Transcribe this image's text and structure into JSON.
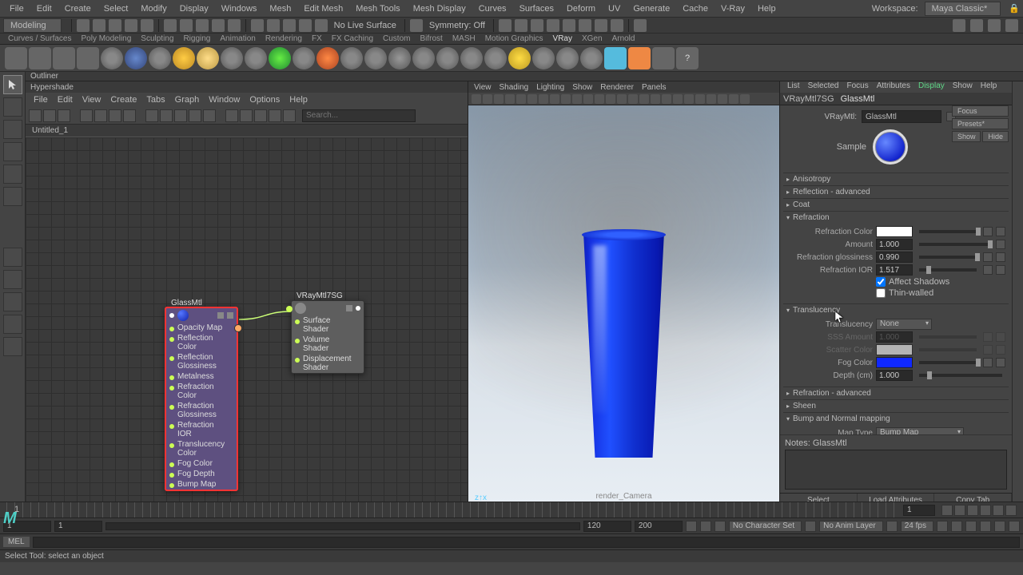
{
  "menubar": [
    "File",
    "Edit",
    "Create",
    "Select",
    "Modify",
    "Display",
    "Windows",
    "Mesh",
    "Edit Mesh",
    "Mesh Tools",
    "Mesh Display",
    "Curves",
    "Surfaces",
    "Deform",
    "UV",
    "Generate",
    "Cache",
    "V-Ray",
    "Help"
  ],
  "workspace": {
    "label": "Workspace:",
    "value": "Maya Classic*"
  },
  "mode": "Modeling",
  "status": {
    "live": "No Live Surface",
    "symmetry": "Symmetry: Off"
  },
  "shelf_tabs": [
    "Curves / Surfaces",
    "Poly Modeling",
    "Sculpting",
    "Rigging",
    "Animation",
    "Rendering",
    "FX",
    "FX Caching",
    "Custom",
    "Bifrost",
    "MASH",
    "Motion Graphics",
    "VRay",
    "XGen",
    "Arnold"
  ],
  "shelf_active": "VRay",
  "outliner": "Outliner",
  "hypershade": {
    "title": "Hypershade",
    "menu": [
      "File",
      "Edit",
      "View",
      "Create",
      "Tabs",
      "Graph",
      "Window",
      "Options",
      "Help"
    ],
    "search_ph": "Search...",
    "tab": "Untitled_1"
  },
  "node1": {
    "title": "GlassMtl",
    "attrs": [
      "Opacity Map",
      "Reflection Color",
      "Reflection Glossiness",
      "Metalness",
      "Refraction Color",
      "Refraction Glossiness",
      "Refraction IOR",
      "Translucency Color",
      "Fog Color",
      "Fog Depth",
      "Bump Map"
    ]
  },
  "node2": {
    "title": "VRayMtl7SG",
    "attrs": [
      "Surface Shader",
      "Volume Shader",
      "Displacement Shader"
    ]
  },
  "viewport": {
    "menu": [
      "View",
      "Shading",
      "Lighting",
      "Show",
      "Renderer",
      "Panels"
    ],
    "camera": "render_Camera",
    "axis": "z↑x"
  },
  "attr": {
    "menu": [
      "List",
      "Selected",
      "Focus",
      "Attributes",
      "Display",
      "Show",
      "Help"
    ],
    "menu_active": "Display",
    "tabs": [
      "VRayMtl7SG",
      "GlassMtl"
    ],
    "tab_active": "GlassMtl",
    "type_label": "VRayMtl:",
    "name": "GlassMtl",
    "side_btns": [
      "Focus",
      "Presets*",
      "Show",
      "Hide"
    ],
    "sample_label": "Sample",
    "sections_collapsed_top": [
      "Anisotropy",
      "Reflection - advanced",
      "Coat"
    ],
    "refraction": {
      "title": "Refraction",
      "color_label": "Refraction Color",
      "color": "#ffffff",
      "amount_label": "Amount",
      "amount": "1.000",
      "gloss_label": "Refraction glossiness",
      "gloss": "0.990",
      "ior_label": "Refraction IOR",
      "ior": "1.517",
      "shadows_label": "Affect Shadows",
      "thin_label": "Thin-walled"
    },
    "translucency": {
      "title": "Translucency",
      "dd_label": "Translucency",
      "dd_value": "None",
      "sss_label": "SSS Amount",
      "sss": "1.000",
      "scatter_label": "Scatter Color",
      "scatter": "#ffffff",
      "fog_label": "Fog Color",
      "fog": "#1028ff",
      "depth_label": "Depth (cm)",
      "depth": "1.000"
    },
    "sections_collapsed_bottom": [
      "Refraction - advanced",
      "Sheen",
      "Bump and Normal mapping"
    ],
    "maptype": {
      "label": "Map Type",
      "value": "Bump Map"
    },
    "notes_label": "Notes: GlassMtl",
    "footer": [
      "Select",
      "Load Attributes",
      "Copy Tab"
    ]
  },
  "timeline": {
    "start": "1",
    "end": "120",
    "cur": "1"
  },
  "range": {
    "s1": "1",
    "s2": "1",
    "e1": "120",
    "e2": "200",
    "charset": "No Character Set",
    "animlayer": "No Anim Layer",
    "fps": "24 fps"
  },
  "cmd": "MEL",
  "help": "Select Tool: select an object"
}
